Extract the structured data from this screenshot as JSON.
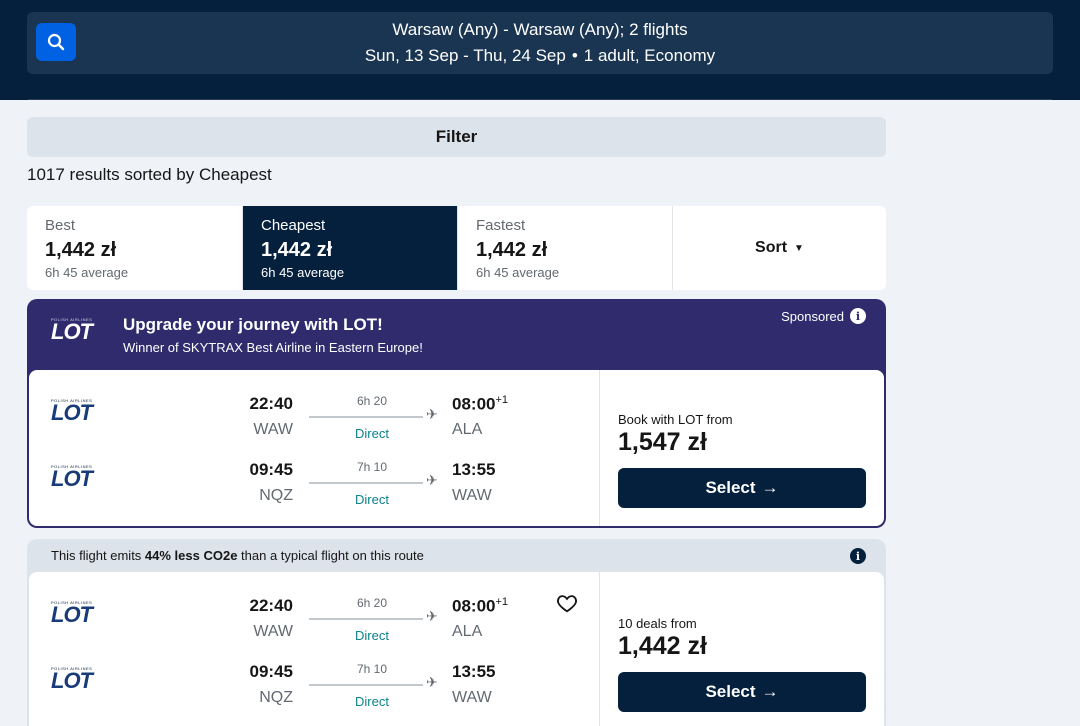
{
  "search": {
    "route": "Warsaw (Any) - Warsaw (Any); 2 flights",
    "dates": "Sun, 13 Sep - Thu, 24 Sep",
    "passengers": "1 adult, Economy",
    "icon": "search-icon"
  },
  "filter": {
    "label": "Filter"
  },
  "results": {
    "summary": "1017 results sorted by Cheapest"
  },
  "sort_tabs": [
    {
      "label": "Best",
      "price": "1,442 zł",
      "average": "6h 45 average",
      "active": false
    },
    {
      "label": "Cheapest",
      "price": "1,442 zł",
      "average": "6h 45 average",
      "active": true
    },
    {
      "label": "Fastest",
      "price": "1,442 zł",
      "average": "6h 45 average",
      "active": false
    }
  ],
  "sort_button": {
    "label": "Sort"
  },
  "sponsored": {
    "airline_logo": "LOT",
    "airline_logo_tagline": "POLISH AIRLINES",
    "title": "Upgrade your journey with LOT!",
    "subtitle": "Winner of SKYTRAX Best Airline in Eastern Europe!",
    "tag": "Sponsored",
    "outbound": {
      "dep_time": "22:40",
      "dep_code": "WAW",
      "duration": "6h 20",
      "stops": "Direct",
      "arr_time": "08:00",
      "arr_offset": "+1",
      "arr_code": "ALA"
    },
    "inbound": {
      "dep_time": "09:45",
      "dep_code": "NQZ",
      "duration": "7h 10",
      "stops": "Direct",
      "arr_time": "13:55",
      "arr_code": "WAW"
    },
    "price_label": "Book with LOT from",
    "price": "1,547 zł",
    "select_label": "Select"
  },
  "result1": {
    "eco_prefix": "This flight emits ",
    "eco_highlight": "44% less CO2e",
    "eco_suffix": " than a typical flight on this route",
    "airline_logo": "LOT",
    "airline_logo_tagline": "POLISH AIRLINES",
    "outbound": {
      "dep_time": "22:40",
      "dep_code": "WAW",
      "duration": "6h 20",
      "stops": "Direct",
      "arr_time": "08:00",
      "arr_offset": "+1",
      "arr_code": "ALA"
    },
    "inbound": {
      "dep_time": "09:45",
      "dep_code": "NQZ",
      "duration": "7h 10",
      "stops": "Direct",
      "arr_time": "13:55",
      "arr_code": "WAW"
    },
    "price_label": "10 deals from",
    "price": "1,442 zł",
    "select_label": "Select"
  },
  "colors": {
    "header_bg": "#05203c",
    "sponsored_bg": "#2f2b6d",
    "accent_blue": "#0062e3",
    "direct_teal": "#0c838a"
  }
}
